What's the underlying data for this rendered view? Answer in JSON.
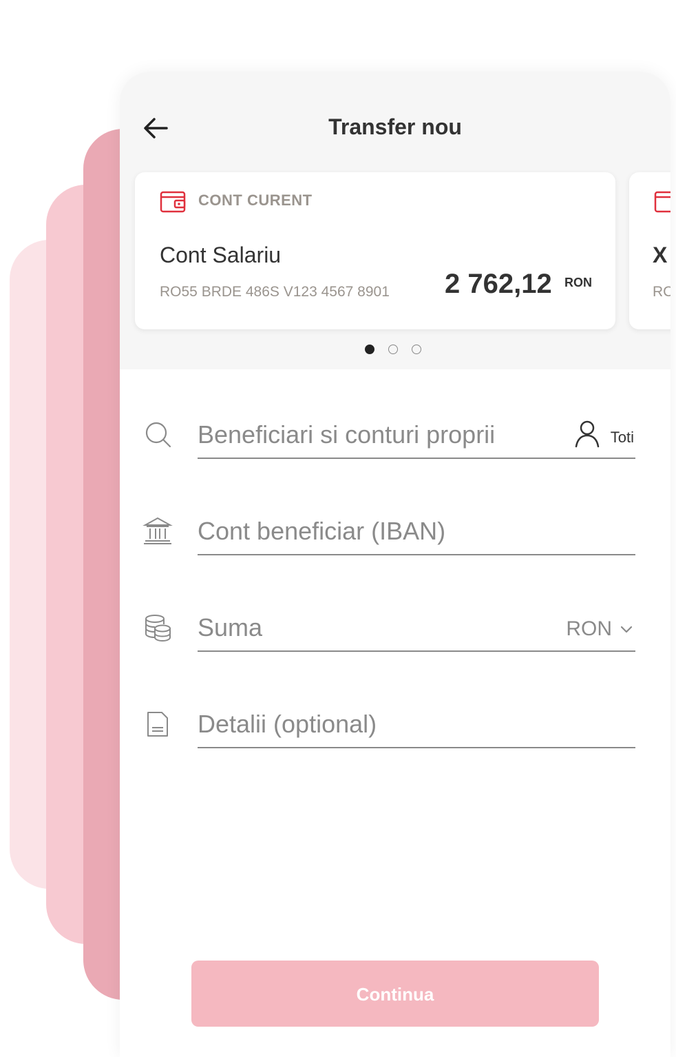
{
  "header": {
    "title": "Transfer nou"
  },
  "accounts": [
    {
      "type": "CONT CURENT",
      "name": "Cont Salariu",
      "iban": "RO55 BRDE 486S V123 4567 8901",
      "balance": "2 762,12",
      "currency": "RON"
    },
    {
      "name_partial": "X",
      "iban_partial": "RC"
    }
  ],
  "carousel": {
    "total": 3,
    "active": 1
  },
  "form": {
    "beneficiary_placeholder": "Beneficiari si conturi proprii",
    "contacts_label": "Toti",
    "iban_placeholder": "Cont beneficiar (IBAN)",
    "amount_placeholder": "Suma",
    "amount_currency": "RON",
    "details_placeholder": "Detalii (optional)"
  },
  "actions": {
    "continue_label": "Continua"
  },
  "colors": {
    "accent": "#e0303d",
    "button": "#f5b8c0",
    "deco_light": "#fbe3e7",
    "deco_mid": "#f7c9d1",
    "deco_dark": "#eaa9b4"
  }
}
